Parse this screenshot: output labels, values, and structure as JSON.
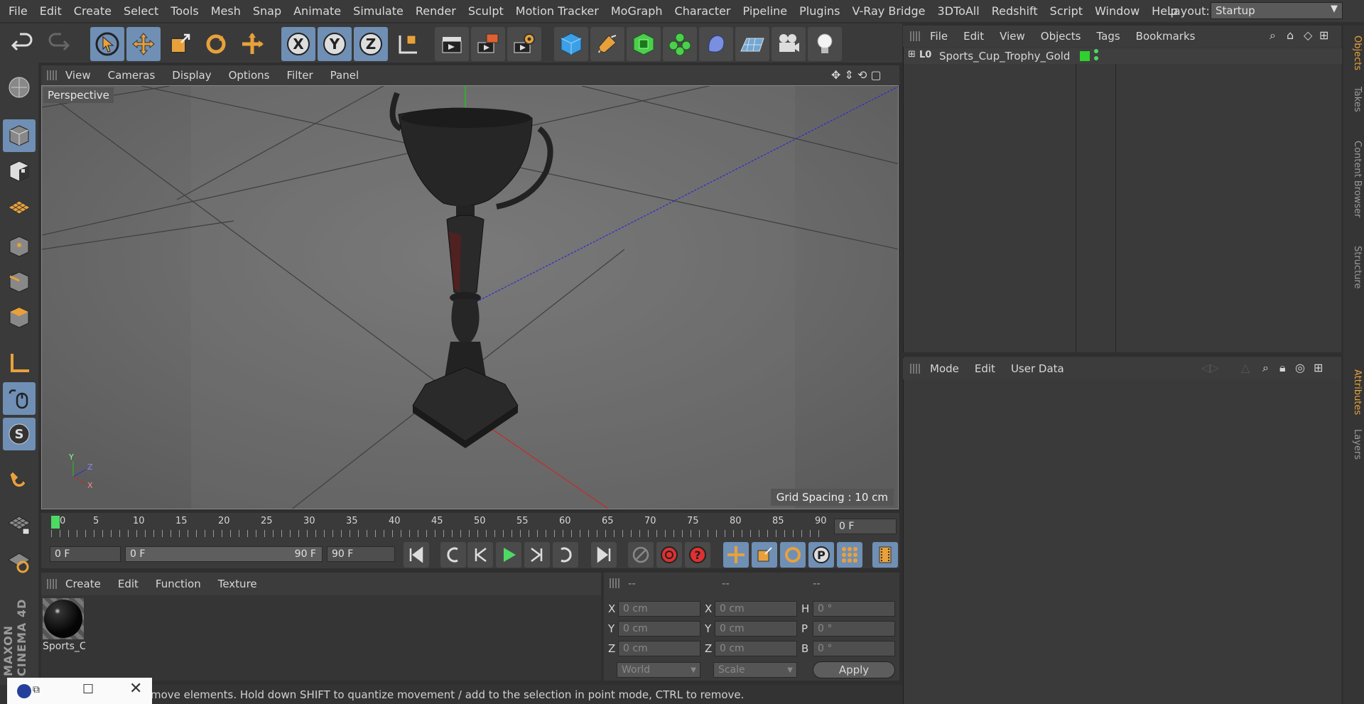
{
  "menubar": {
    "items": [
      "File",
      "Edit",
      "Create",
      "Select",
      "Tools",
      "Mesh",
      "Snap",
      "Animate",
      "Simulate",
      "Render",
      "Sculpt",
      "Motion Tracker",
      "MoGraph",
      "Character",
      "Pipeline",
      "Plugins",
      "V-Ray Bridge",
      "3DToAll",
      "Redshift",
      "Script",
      "Window",
      "Help"
    ],
    "layout_label": "Layout:",
    "layout_value": "Startup"
  },
  "toolbar": {
    "x_label": "X",
    "y_label": "Y",
    "z_label": "Z"
  },
  "viewport": {
    "menu": [
      "View",
      "Cameras",
      "Display",
      "Options",
      "Filter",
      "Panel"
    ],
    "camera_label": "Perspective",
    "grid_spacing": "Grid Spacing : 10 cm",
    "axis_labels": {
      "y": "Y",
      "z": "Z",
      "x": "X"
    }
  },
  "timeline": {
    "ticks": [
      "0",
      "5",
      "10",
      "15",
      "20",
      "25",
      "30",
      "35",
      "40",
      "45",
      "50",
      "55",
      "60",
      "65",
      "70",
      "75",
      "80",
      "85",
      "90"
    ],
    "current_frame": "0 F"
  },
  "controls": {
    "start_frame": "0 F",
    "range_start": "0 F",
    "range_end": "90 F",
    "end_frame": "90 F"
  },
  "material_panel": {
    "menu": [
      "Create",
      "Edit",
      "Function",
      "Texture"
    ],
    "material_name": "Sports_C"
  },
  "coords": {
    "headers": [
      "--",
      "--",
      "--"
    ],
    "rows": [
      {
        "a_label": "X",
        "a_val": "0 cm",
        "b_label": "X",
        "b_val": "0 cm",
        "c_label": "H",
        "c_val": "0 °"
      },
      {
        "a_label": "Y",
        "a_val": "0 cm",
        "b_label": "Y",
        "b_val": "0 cm",
        "c_label": "P",
        "c_val": "0 °"
      },
      {
        "a_label": "Z",
        "a_val": "0 cm",
        "b_label": "Z",
        "b_val": "0 cm",
        "c_label": "B",
        "c_val": "0 °"
      }
    ],
    "space": "World",
    "mode": "Scale",
    "apply": "Apply"
  },
  "objects_panel": {
    "menu": [
      "File",
      "Edit",
      "View",
      "Objects",
      "Tags",
      "Bookmarks"
    ],
    "object_name": "Sports_Cup_Trophy_Gold"
  },
  "attributes_panel": {
    "menu": [
      "Mode",
      "Edit",
      "User Data"
    ]
  },
  "sidetabs": {
    "top": [
      "Objects",
      "Takes",
      "Content Browser",
      "Structure"
    ],
    "bottom": [
      "Attributes",
      "Layers"
    ]
  },
  "brand": "MAXON CINEMA 4D",
  "status": "move elements. Hold down SHIFT to quantize movement / add to the selection in point mode, CTRL to remove.",
  "colors": {
    "accent_blue": "#6f8fb5",
    "orange_icon": "#e8a13a",
    "timeline_marker": "#4cd964"
  }
}
